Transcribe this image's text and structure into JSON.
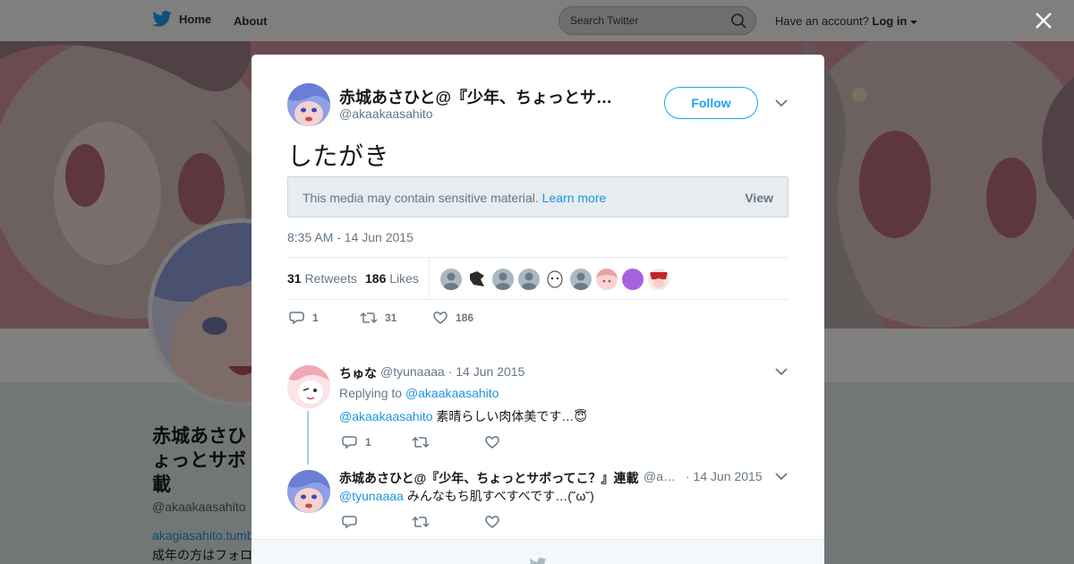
{
  "nav": {
    "home_label": "Home",
    "about_label": "About",
    "search_placeholder": "Search Twitter",
    "have_account": "Have an account?",
    "login_label": "Log in"
  },
  "profile_bg": {
    "name": "赤城あさひとょっとサボ載",
    "name_line1": "赤城あさひ",
    "name_line2": "ょっとサボ",
    "name_line3": "載",
    "handle": "@akaakaasahito",
    "link": "akagiasahito.tumb",
    "bio": "成年の方はフォロ"
  },
  "tweet": {
    "author_name": "赤城あさひと@『少年、ちょっとサボってこ？』連載",
    "author_name_display": "赤城あさひと@『少年、ちょっとサ…",
    "author_handle": "@akaakaasahito",
    "follow_label": "Follow",
    "text": "したがき",
    "sensitive_msg": "This media may contain sensitive material.",
    "learn_more": "Learn more",
    "view_label": "View",
    "timestamp": "8:35 AM - 14 Jun 2015",
    "retweets_count": "31",
    "retweets_label": "Retweets",
    "likes_count": "186",
    "likes_label": "Likes",
    "reply_count": "1",
    "retweet_count_action": "31",
    "like_count_action": "186"
  },
  "replies": [
    {
      "name": "ちゅな",
      "handle": "@tyunaaaa",
      "date": "· 14 Jun 2015",
      "replying_to_label": "Replying to",
      "replying_to": "@akaakaasahito",
      "mention": "@akaakaasahito",
      "text": "素晴らしい肉体美です…😇",
      "reply_count": "1"
    },
    {
      "name": "赤城あさひと@『少年、ちょっとサボってこ？』連載",
      "handle": "@a…",
      "date": "· 14 Jun 2015",
      "mention": "@tyunaaaa",
      "text": "みんなもち肌すべすべです…(˘ω˘)"
    }
  ],
  "colors": {
    "twitter_blue": "#1da1f2",
    "link_blue": "#1b95e0",
    "muted_text": "#657786"
  }
}
